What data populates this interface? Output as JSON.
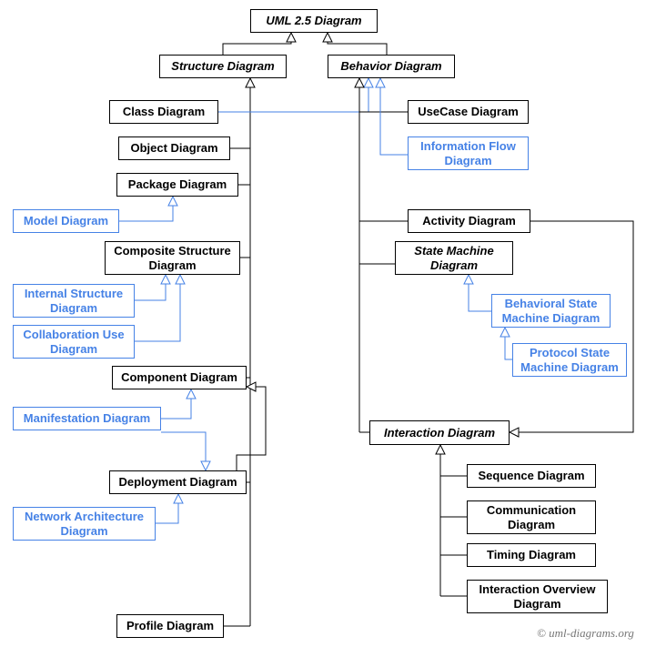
{
  "diagram": {
    "root": "UML 2.5 Diagram",
    "structure": "Structure Diagram",
    "behavior": "Behavior Diagram",
    "classD": "Class Diagram",
    "objectD": "Object Diagram",
    "packageD": "Package Diagram",
    "modelD": "Model Diagram",
    "compStructD": "Composite Structure Diagram",
    "intStructD": "Internal Structure Diagram",
    "collabUseD": "Collaboration Use Diagram",
    "componentD": "Component Diagram",
    "manifestD": "Manifestation Diagram",
    "deployD": "Deployment Diagram",
    "netArchD": "Network Architecture Diagram",
    "profileD": "Profile Diagram",
    "useCaseD": "UseCase Diagram",
    "infoFlowD": "Information Flow Diagram",
    "activityD": "Activity Diagram",
    "stateMachD": "State Machine Diagram",
    "behStateD": "Behavioral State Machine Diagram",
    "protStateD": "Protocol State Machine Diagram",
    "interactionD": "Interaction Diagram",
    "sequenceD": "Sequence Diagram",
    "commD": "Communication Diagram",
    "timingD": "Timing Diagram",
    "interOverD": "Interaction Overview Diagram"
  },
  "credit": "© uml-diagrams.org"
}
